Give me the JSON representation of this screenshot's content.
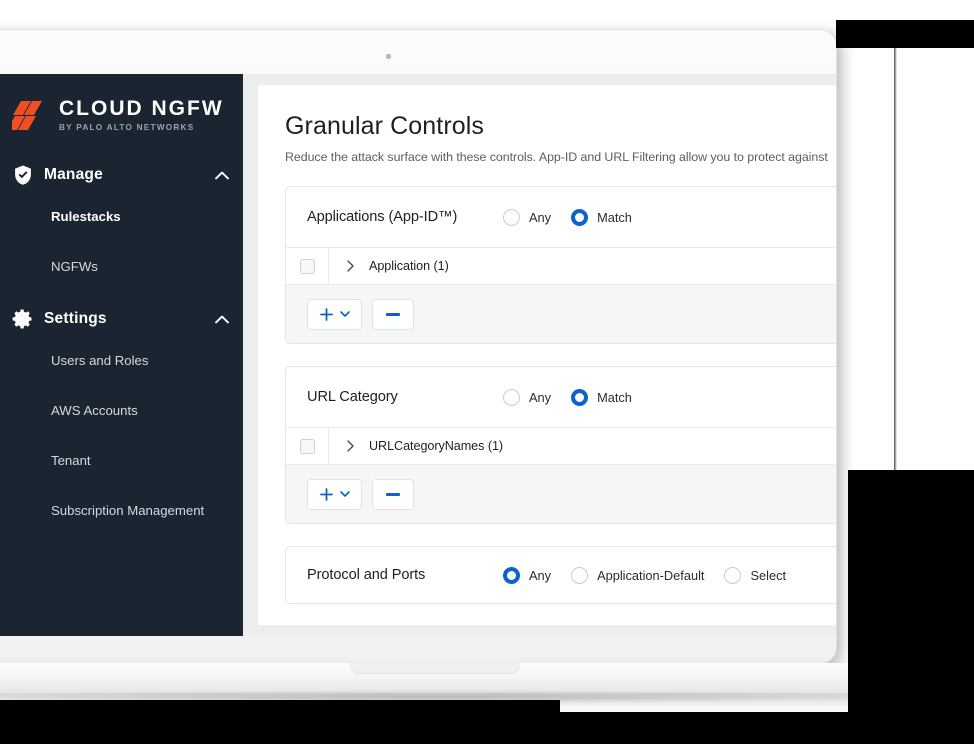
{
  "sidebar": {
    "logo": {
      "mark_icon": "palo-alto-logo-icon",
      "title": "CLOUD NGFW",
      "subtitle": "BY PALO ALTO NETWORKS",
      "accent_color": "#F04E23",
      "background_color": "#1b2532"
    },
    "groups": [
      {
        "label": "Manage",
        "icon": "shield-check-icon",
        "expand_icon": "chevron-up-icon",
        "expanded": true,
        "items": [
          {
            "label": "Rulestacks",
            "active": true
          },
          {
            "label": "NGFWs",
            "active": false
          }
        ]
      },
      {
        "label": "Settings",
        "icon": "gear-icon",
        "expand_icon": "chevron-up-icon",
        "expanded": true,
        "items": [
          {
            "label": "Users and Roles",
            "active": false
          },
          {
            "label": "AWS Accounts",
            "active": false
          },
          {
            "label": "Tenant",
            "active": false
          },
          {
            "label": "Subscription Management",
            "active": false
          }
        ]
      }
    ]
  },
  "main": {
    "title": "Granular Controls",
    "subtitle": "Reduce the attack surface with these controls. App-ID and URL Filtering allow you to protect against",
    "accent_color": "#0d62d0",
    "cards": [
      {
        "title": "Applications (App-ID™)",
        "options": [
          {
            "label": "Any",
            "selected": false
          },
          {
            "label": "Match",
            "selected": true
          }
        ],
        "row": {
          "checkbox_checked": false,
          "expand_icon": "chevron-right-icon",
          "name": "Application (1)"
        },
        "toolbar": {
          "add_icon": "plus-icon",
          "add_dropdown_icon": "chevron-down-icon",
          "remove_icon": "minus-icon"
        }
      },
      {
        "title": "URL Category",
        "options": [
          {
            "label": "Any",
            "selected": false
          },
          {
            "label": "Match",
            "selected": true
          }
        ],
        "row": {
          "checkbox_checked": false,
          "expand_icon": "chevron-right-icon",
          "name": "URLCategoryNames (1)"
        },
        "toolbar": {
          "add_icon": "plus-icon",
          "add_dropdown_icon": "chevron-down-icon",
          "remove_icon": "minus-icon"
        }
      },
      {
        "title": "Protocol and Ports",
        "options": [
          {
            "label": "Any",
            "selected": true
          },
          {
            "label": "Application-Default",
            "selected": false
          },
          {
            "label": "Select",
            "selected": false
          }
        ]
      }
    ]
  },
  "device": {
    "frame": "laptop-mockup",
    "camera_icon": "webcam-dot-icon"
  }
}
